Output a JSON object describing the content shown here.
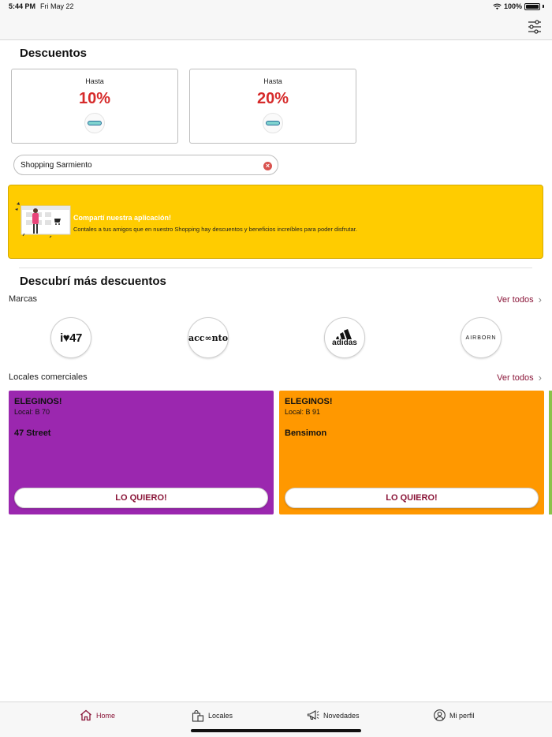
{
  "status_bar": {
    "time": "5:44 PM",
    "date": "Fri May 22",
    "battery": "100%"
  },
  "discounts": {
    "title": "Descuentos",
    "cards": [
      {
        "label": "Hasta",
        "percent": "10%"
      },
      {
        "label": "Hasta",
        "percent": "20%"
      }
    ]
  },
  "search": {
    "value": "Shopping Sarmiento"
  },
  "share_banner": {
    "title": "Compartí nuestra aplicación!",
    "body": "Contales a tus amigos que en nuestro Shopping hay descuentos y beneficios increíbles para poder disfrutar."
  },
  "discover": {
    "title": "Descubrí más descuentos",
    "brands": {
      "label": "Marcas",
      "see_all": "Ver todos",
      "items": [
        {
          "name": "i♥47",
          "text": "i♥47"
        },
        {
          "name": "accento",
          "text": "acc∞nto"
        },
        {
          "name": "adidas",
          "text": "adidas"
        },
        {
          "name": "airborn",
          "text": "AIRBORN"
        }
      ]
    },
    "stores": {
      "label": "Locales comerciales",
      "see_all": "Ver todos",
      "items": [
        {
          "promo": "ELEGINOS!",
          "local": "Local: B 70",
          "name": "47 Street",
          "cta": "LO QUIERO!",
          "color": "#9b27af"
        },
        {
          "promo": "ELEGINOS!",
          "local": "Local: B 91",
          "name": "Bensimon",
          "cta": "LO QUIERO!",
          "color": "#ff9800"
        }
      ]
    }
  },
  "tab_bar": {
    "tabs": [
      {
        "label": "Home",
        "icon": "home-icon",
        "active": true
      },
      {
        "label": "Locales",
        "icon": "shopping-bag-icon"
      },
      {
        "label": "Novedades",
        "icon": "megaphone-icon"
      },
      {
        "label": "Mi perfil",
        "icon": "profile-icon"
      }
    ]
  },
  "colors": {
    "accent": "#8a1538",
    "discount_red": "#d62b2b",
    "banner_yellow": "#ffcc00"
  }
}
